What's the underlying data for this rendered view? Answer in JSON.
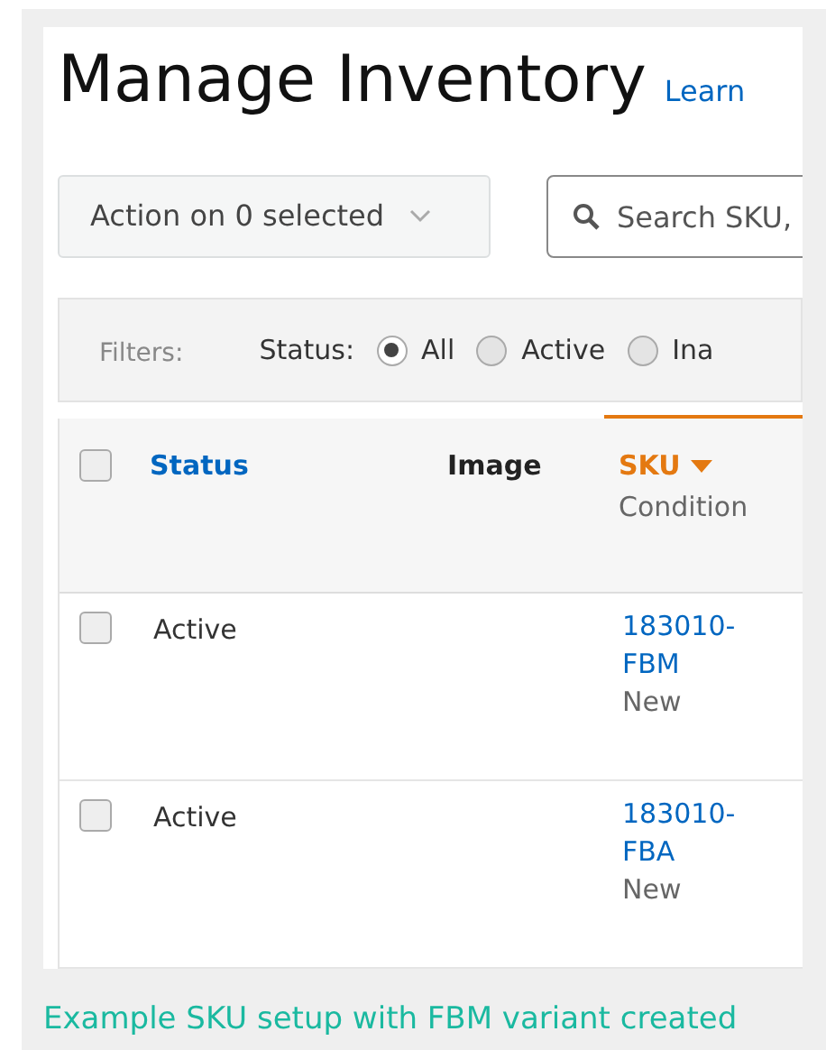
{
  "page": {
    "title": "Manage Inventory",
    "learn_link": "Learn"
  },
  "action_dropdown": {
    "label": "Action on 0 selected"
  },
  "search": {
    "placeholder": "Search SKU,"
  },
  "filters": {
    "label": "Filters:",
    "status_label": "Status:",
    "options": [
      {
        "label": "All",
        "selected": true
      },
      {
        "label": "Active",
        "selected": false
      },
      {
        "label": "Ina",
        "selected": false
      }
    ]
  },
  "table": {
    "select_all_checked": false,
    "columns": [
      {
        "label": "Status",
        "kind": "link",
        "sorted": false
      },
      {
        "label": "Image",
        "kind": "plain",
        "sorted": false
      },
      {
        "label": "SKU",
        "kind": "link",
        "sorted": true,
        "sub_label": "Condition"
      }
    ],
    "rows": [
      {
        "checked": false,
        "status": "Active",
        "sku": "183010-\nFBM",
        "condition": "New"
      },
      {
        "checked": false,
        "status": "Active",
        "sku": "183010-\nFBA",
        "condition": "New"
      }
    ]
  },
  "caption": "Example SKU setup with FBM variant created"
}
